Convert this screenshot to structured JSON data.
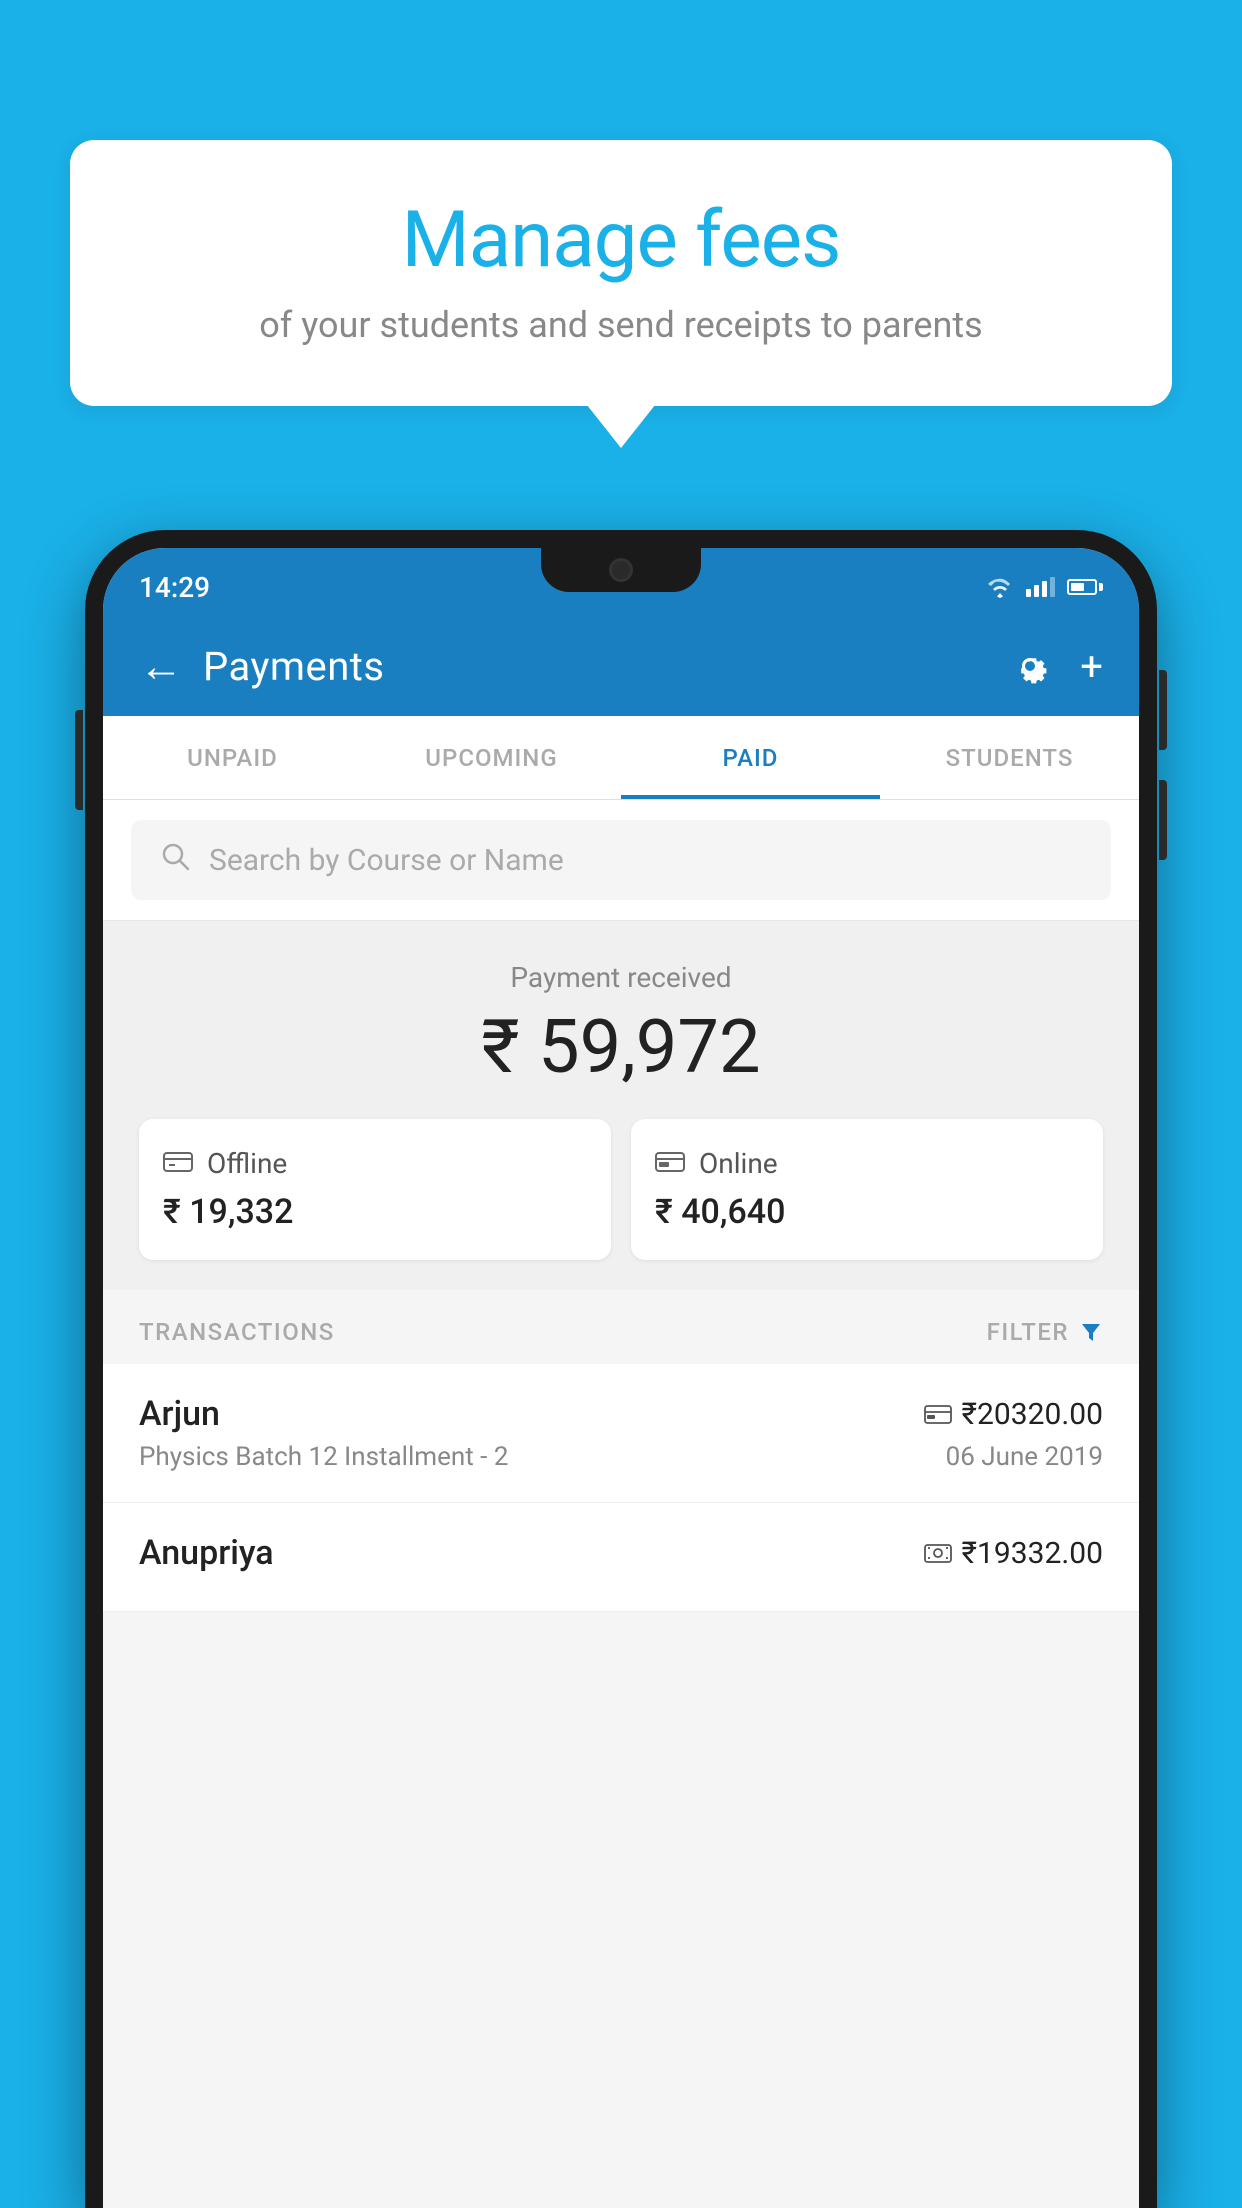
{
  "background": {
    "color": "#1ab0e8"
  },
  "speech_bubble": {
    "title": "Manage fees",
    "subtitle": "of your students and send receipts to parents"
  },
  "phone": {
    "status_bar": {
      "time": "14:29"
    },
    "header": {
      "title": "Payments",
      "back_label": "←",
      "plus_label": "+"
    },
    "tabs": [
      {
        "label": "UNPAID",
        "active": false
      },
      {
        "label": "UPCOMING",
        "active": false
      },
      {
        "label": "PAID",
        "active": true
      },
      {
        "label": "STUDENTS",
        "active": false
      }
    ],
    "search": {
      "placeholder": "Search by Course or Name"
    },
    "payment_summary": {
      "label": "Payment received",
      "total": "₹ 59,972",
      "offline_label": "Offline",
      "offline_amount": "₹ 19,332",
      "online_label": "Online",
      "online_amount": "₹ 40,640"
    },
    "transactions": {
      "section_label": "TRANSACTIONS",
      "filter_label": "FILTER",
      "rows": [
        {
          "name": "Arjun",
          "course": "Physics Batch 12 Installment - 2",
          "amount": "₹20320.00",
          "date": "06 June 2019",
          "payment_type": "card"
        },
        {
          "name": "Anupriya",
          "course": "",
          "amount": "₹19332.00",
          "date": "",
          "payment_type": "cash"
        }
      ]
    }
  }
}
